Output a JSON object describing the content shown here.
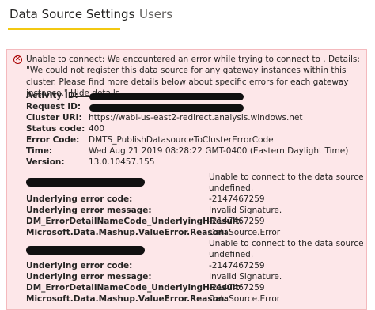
{
  "tabs": [
    {
      "label": "Data Source Settings",
      "active": true
    },
    {
      "label": "Users",
      "active": false
    }
  ],
  "error": {
    "message": "Unable to connect: We encountered an error while trying to connect to . Details: \"We could not register this data source for any gateway instances within this cluster. Please find more details below about specific errors for each gateway instance.\"",
    "hide_link": "Hide details",
    "fields": {
      "activity_id_label": "Activity ID:",
      "request_id_label": "Request ID:",
      "cluster_uri_label": "Cluster URI:",
      "cluster_uri_value": "https://wabi-us-east2-redirect.analysis.windows.net",
      "status_code_label": "Status code:",
      "status_code_value": "400",
      "error_code_label": "Error Code:",
      "error_code_value": "DMTS_PublishDatasourceToClusterErrorCode",
      "time_label": "Time:",
      "time_value": "Wed Aug 21 2019 08:28:22 GMT-0400 (Eastern Daylight Time)",
      "version_label": "Version:",
      "version_value": "13.0.10457.155"
    },
    "gateways": [
      {
        "msg_line1": "Unable to connect to the data source",
        "msg_line2": "undefined.",
        "code_label": "Underlying error code:",
        "code_value": "-2147467259",
        "message_label": "Underlying error message:",
        "message_value": "Invalid Signature.",
        "hresult_label": "DM_ErrorDetailNameCode_UnderlyingHResult:",
        "hresult_value": "-2147467259",
        "reason_label": "Microsoft.Data.Mashup.ValueError.Reason:",
        "reason_value": "DataSource.Error"
      },
      {
        "msg_line1": "Unable to connect to the data source",
        "msg_line2": "undefined.",
        "code_label": "Underlying error code:",
        "code_value": "-2147467259",
        "message_label": "Underlying error message:",
        "message_value": "Invalid Signature.",
        "hresult_label": "DM_ErrorDetailNameCode_UnderlyingHResult:",
        "hresult_value": "-2147467259",
        "reason_label": "Microsoft.Data.Mashup.ValueError.Reason:",
        "reason_value": "DataSource.Error"
      }
    ]
  }
}
